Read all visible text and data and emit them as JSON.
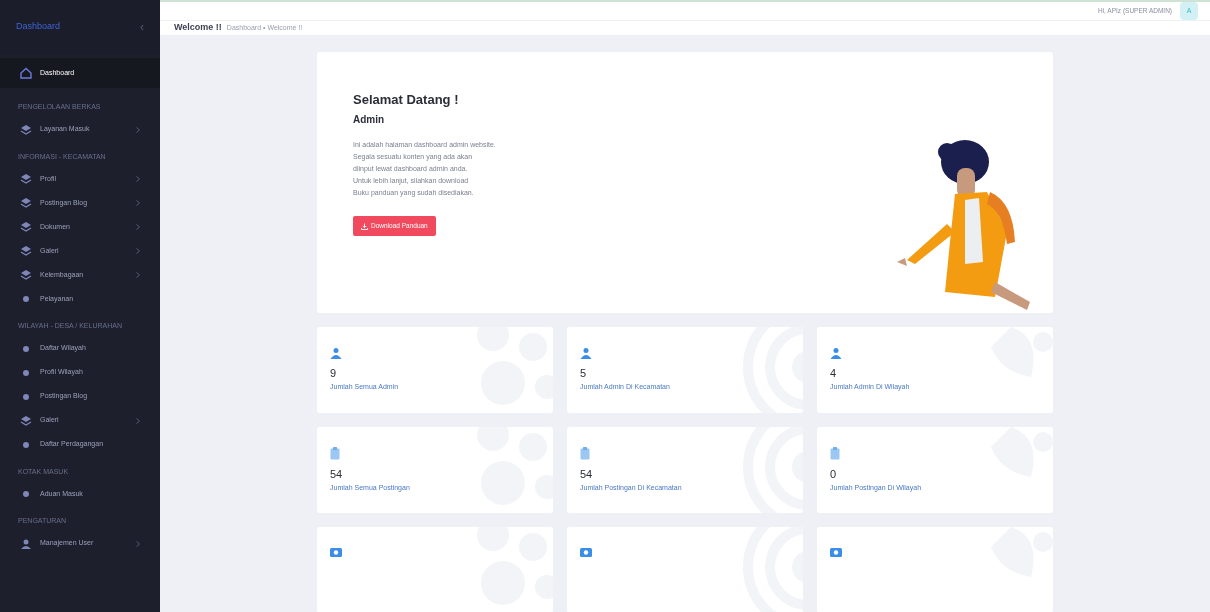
{
  "sidebar": {
    "brand": "Dashboard",
    "collapse_icon": "‹",
    "sections": [
      {
        "items": [
          {
            "label": "Dashboard",
            "kind": "home",
            "selected": true,
            "submenu": false
          }
        ]
      },
      {
        "heading": "PENGELOLAAN BERKAS",
        "items": [
          {
            "label": "Layanan Masuk",
            "kind": "layer",
            "selected": false,
            "submenu": true
          }
        ]
      },
      {
        "heading": "INFORMASI - KECAMATAN",
        "items": [
          {
            "label": "Profil",
            "kind": "layer",
            "selected": false,
            "submenu": true
          },
          {
            "label": "Postingan Blog",
            "kind": "layer",
            "selected": false,
            "submenu": true
          },
          {
            "label": "Dokumen",
            "kind": "layer",
            "selected": false,
            "submenu": true
          },
          {
            "label": "Galeri",
            "kind": "layer",
            "selected": false,
            "submenu": true
          },
          {
            "label": "Kelembagaan",
            "kind": "layer",
            "selected": false,
            "submenu": true
          },
          {
            "label": "Pelayanan",
            "kind": "dot",
            "selected": false,
            "submenu": false
          }
        ]
      },
      {
        "heading": "WILAYAH - DESA / KELURAHAN",
        "items": [
          {
            "label": "Daftar Wilayah",
            "kind": "dot",
            "selected": false,
            "submenu": false
          },
          {
            "label": "Profil Wilayah",
            "kind": "dot",
            "selected": false,
            "submenu": false
          },
          {
            "label": "Postingan Blog",
            "kind": "dot",
            "selected": false,
            "submenu": false
          },
          {
            "label": "Galeri",
            "kind": "layer",
            "selected": false,
            "submenu": true
          },
          {
            "label": "Daftar Perdagangan",
            "kind": "dot",
            "selected": false,
            "submenu": false
          }
        ]
      },
      {
        "heading": "KOTAK MASUK",
        "items": [
          {
            "label": "Aduan Masuk",
            "kind": "dot",
            "selected": false,
            "submenu": false
          }
        ]
      },
      {
        "heading": "PENGATURAN",
        "items": [
          {
            "label": "Manajemen User",
            "kind": "user",
            "selected": false,
            "submenu": true
          }
        ]
      }
    ]
  },
  "topbar": {
    "greeting": "Hi, APIz (SUPER ADMIN)",
    "avatar": "A"
  },
  "subheader": {
    "title": "Welcome !!",
    "breadcrumb": "Dashboard • Welcome !!"
  },
  "welcome": {
    "title": "Selamat Datang !",
    "subtitle": "Admin",
    "lines": [
      "Ini adalah halaman dashboard admin website.",
      "Segala sesuatu konten yang ada akan",
      "diinput lewat dashboard admin anda.",
      "Untuk lebih lanjut, silahkan download",
      "Buku panduan yang sudah disediakan."
    ],
    "button": "Download Panduan"
  },
  "stats": [
    {
      "kind": "user",
      "value": "9",
      "label": "Jumlah Semua Admin"
    },
    {
      "kind": "user",
      "value": "5",
      "label": "Jumlah Admin Di Kecamatan"
    },
    {
      "kind": "user",
      "value": "4",
      "label": "Jumlah Admin Di Wilayah"
    },
    {
      "kind": "clipboard",
      "value": "54",
      "label": "Jumlah Semua Postingan"
    },
    {
      "kind": "clipboard",
      "value": "54",
      "label": "Jumlah Postingan Di Kecamatan"
    },
    {
      "kind": "clipboard",
      "value": "0",
      "label": "Jumlah Postingan Di Wilayah"
    },
    {
      "kind": "camera"
    },
    {
      "kind": "camera"
    },
    {
      "kind": "camera"
    }
  ]
}
